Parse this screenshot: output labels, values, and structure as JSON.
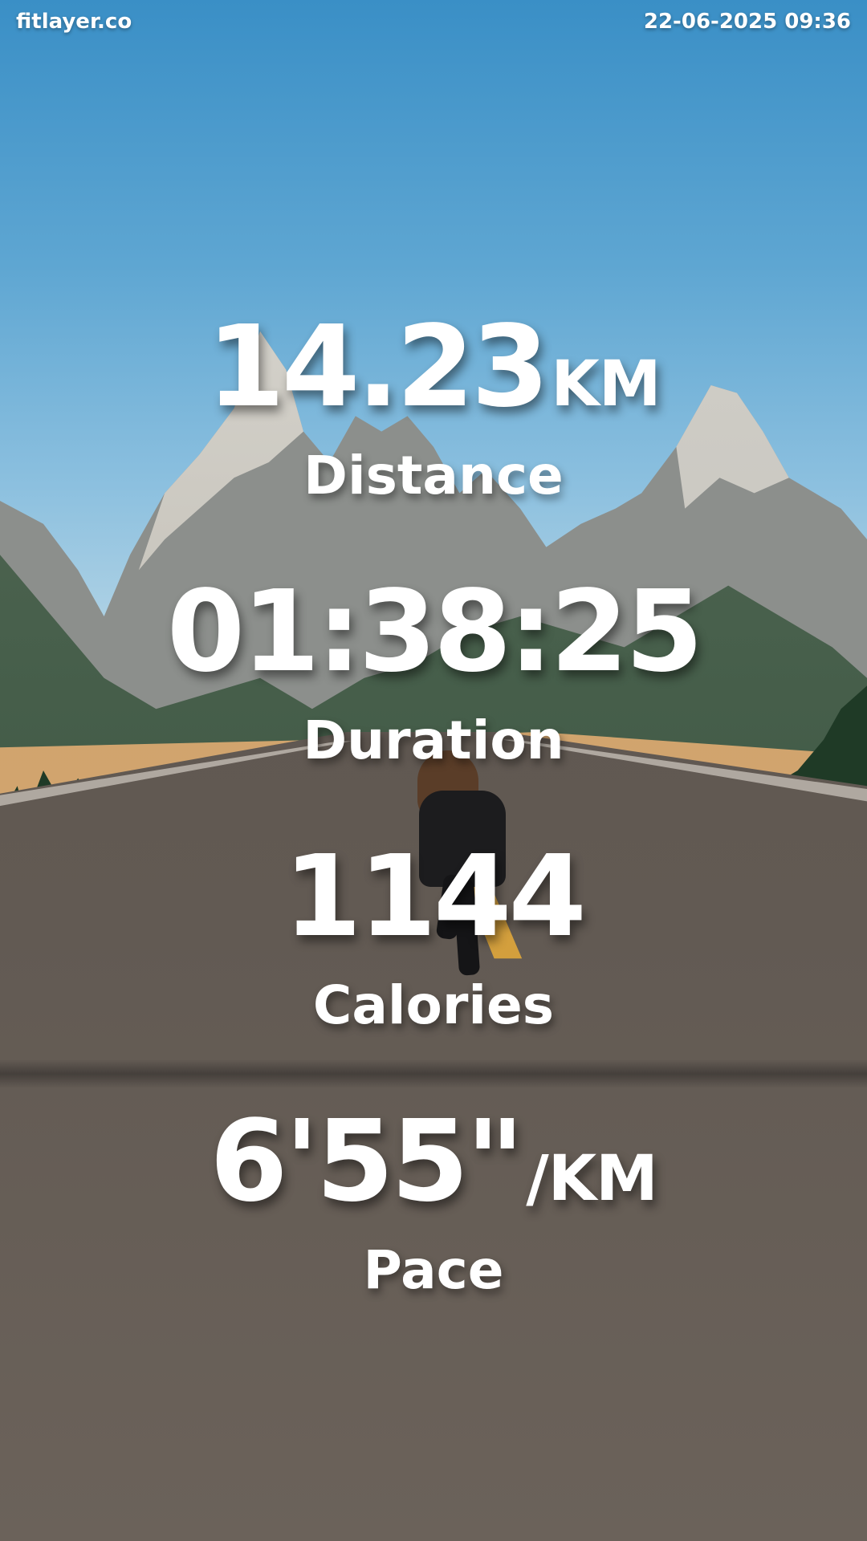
{
  "header": {
    "brand": "fitlayer.co",
    "datetime": "22-06-2025 09:36"
  },
  "stats": {
    "distance": {
      "value": "14.23",
      "unit": "KM",
      "label": "Distance"
    },
    "duration": {
      "value": "01:38:25",
      "label": "Duration"
    },
    "calories": {
      "value": "1144",
      "label": "Calories"
    },
    "pace": {
      "value": "6'55\"",
      "unit": "/KM",
      "label": "Pace"
    }
  },
  "colors": {
    "text": "#ffffff",
    "sky": "#3a8fc6",
    "road": "#5e5650",
    "centerline": "#d9a33c"
  }
}
